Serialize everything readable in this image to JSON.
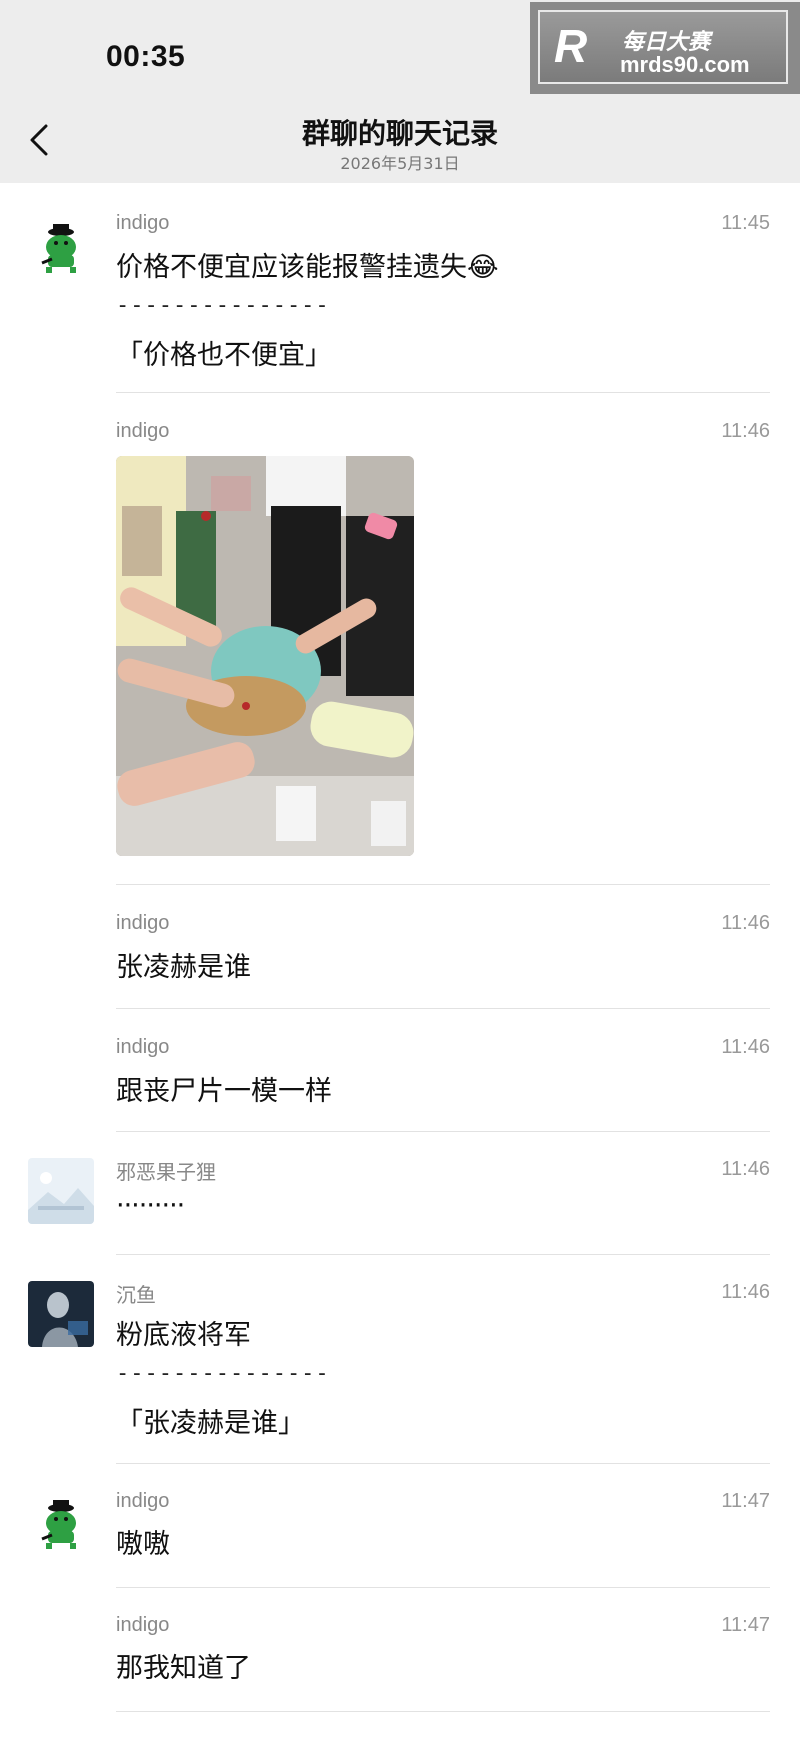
{
  "status_bar": {
    "time": "00:35"
  },
  "watermark": {
    "logo": "R",
    "brand_cn": "每日大赛",
    "url": "mrds90.com"
  },
  "nav": {
    "back_icon": "chevron-left-icon",
    "title": "群聊的聊天记录",
    "date": "2026年5月31日"
  },
  "messages": [
    {
      "sender": "indigo",
      "time": "11:45",
      "text": "价格不便宜应该能报警挂遗失",
      "emoji": "😂",
      "quote_separator": "---------------",
      "quote": "「价格也不便宜」",
      "avatar": "green-frog-avatar"
    },
    {
      "sender": "indigo",
      "time": "11:46",
      "type": "image",
      "image": "photo-of-hands-around-backpack"
    },
    {
      "sender": "indigo",
      "time": "11:46",
      "text": "张凌赫是谁"
    },
    {
      "sender": "indigo",
      "time": "11:46",
      "text": "跟丧尸片一模一样"
    },
    {
      "sender": "邪恶果子狸",
      "time": "11:46",
      "text": "·········",
      "avatar": "landscape-placeholder-avatar"
    },
    {
      "sender": "沉鱼",
      "time": "11:46",
      "text": "粉底液将军",
      "quote_separator": "---------------",
      "quote": "「张凌赫是谁」",
      "avatar": "dark-portrait-avatar"
    },
    {
      "sender": "indigo",
      "time": "11:47",
      "text": "嗷嗷",
      "avatar": "green-frog-avatar"
    },
    {
      "sender": "indigo",
      "time": "11:47",
      "text": "那我知道了"
    }
  ]
}
